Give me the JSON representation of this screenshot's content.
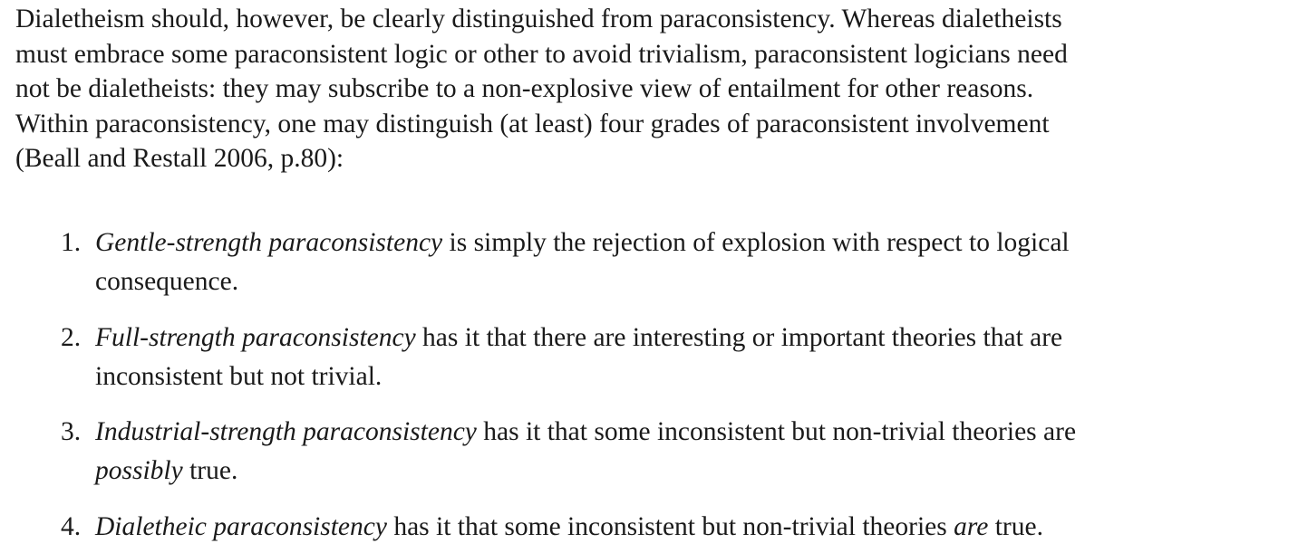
{
  "paragraph": {
    "lines": [
      "Dialetheism should, however, be clearly distinguished from paraconsistency. Whereas dialetheists",
      "must embrace some paraconsistent logic or other to avoid trivialism, paraconsistent logicians need",
      "not be dialetheists: they may subscribe to a non-explosive view of entailment for other reasons.",
      "Within paraconsistency, one may distinguish (at least) four grades of paraconsistent involvement",
      "(Beall and Restall 2006, p.80):"
    ]
  },
  "grades": [
    {
      "number": "1.",
      "term": "Gentle-strength paraconsistency",
      "line1_rest": " is simply the rejection of explosion with respect to logical",
      "line2": "consequence."
    },
    {
      "number": "2.",
      "term": "Full-strength paraconsistency",
      "line1_rest": " has it that there are interesting or important theories that are",
      "line2": "inconsistent but not trivial."
    },
    {
      "number": "3.",
      "term": "Industrial-strength paraconsistency",
      "line1_rest": " has it that some inconsistent but non-trivial theories are",
      "line2_em": "possibly",
      "line2_rest": " true."
    },
    {
      "number": "4.",
      "term": "Dialetheic paraconsistency",
      "line1_rest": " has it that some inconsistent but non-trivial theories ",
      "line1_em": "are",
      "line1_tail": " true."
    }
  ]
}
